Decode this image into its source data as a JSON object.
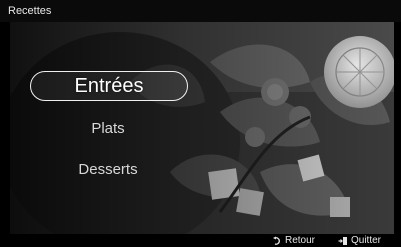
{
  "header": {
    "title": "Recettes"
  },
  "menu": {
    "items": [
      {
        "label": "Entrées",
        "selected": true
      },
      {
        "label": "Plats",
        "selected": false
      },
      {
        "label": "Desserts",
        "selected": false
      }
    ]
  },
  "footer": {
    "back_label": "Retour",
    "back_icon": "return-arrow-icon",
    "quit_label": "Quitter",
    "quit_icon": "exit-door-icon"
  },
  "colors": {
    "selection_outline": "#f0f0f0",
    "text": "#e0e0e0",
    "background": "#000000"
  }
}
